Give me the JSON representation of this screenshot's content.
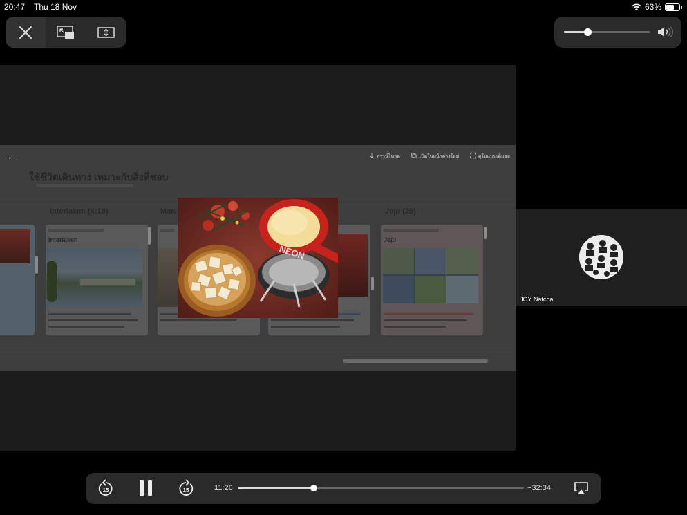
{
  "status_bar": {
    "time": "20:47",
    "date": "Thu 18 Nov",
    "battery": "63%",
    "battery_level": 0.63
  },
  "volume": {
    "level": 0.27
  },
  "shared_screen": {
    "actions": [
      "ดาวน์โหลด",
      "เปิดในหน้าต่างใหม่",
      "ดูในแบบเต็มจอ"
    ],
    "heading": "ใช้ชีวิตเดินทาง เหมาะกับสิ่งที่ชอบ",
    "columns": [
      {
        "title": "Interlaken (4:18)",
        "card_title": "Interlaken"
      },
      {
        "title": "Man",
        "card_title": ""
      },
      {
        "title": "Jeju (29)",
        "card_title": "Jeju"
      }
    ]
  },
  "participant": {
    "name": "JOY Natcha"
  },
  "playback": {
    "elapsed": "11:26",
    "remaining": "−32:34",
    "skip_seconds": "15",
    "progress": 0.265
  },
  "colors": {
    "panel": "#2a2a2a",
    "background": "#000000",
    "video": "#1b1b1b"
  }
}
